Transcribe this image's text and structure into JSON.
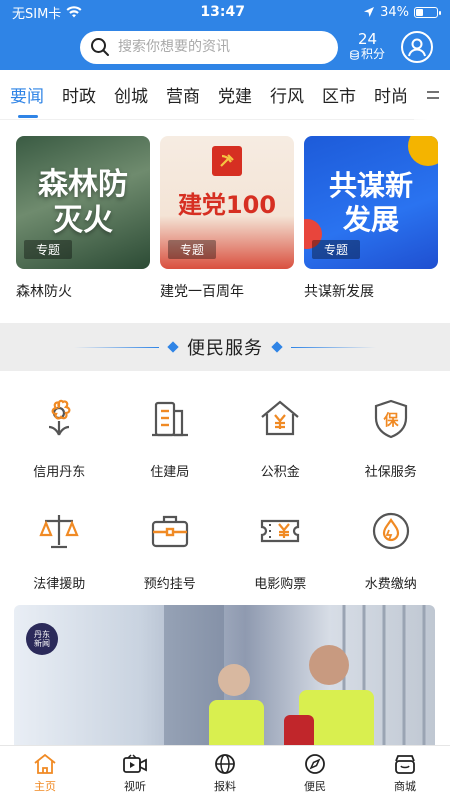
{
  "status": {
    "carrier": "无SIM卡",
    "time": "13:47",
    "battery": "34%",
    "battery_level": 0.34
  },
  "header": {
    "search_placeholder": "搜索你想要的资讯",
    "points_value": "24",
    "points_label": "积分"
  },
  "tabs": [
    {
      "label": "要闻",
      "active": true
    },
    {
      "label": "时政"
    },
    {
      "label": "创城"
    },
    {
      "label": "营商"
    },
    {
      "label": "党建"
    },
    {
      "label": "行风"
    },
    {
      "label": "区市"
    },
    {
      "label": "时尚"
    }
  ],
  "topics": [
    {
      "image_text": "森林防灭火",
      "tag": "专题",
      "caption": "森林防火"
    },
    {
      "image_text": "建党100",
      "tag": "专题",
      "caption": "建党一百周年"
    },
    {
      "image_text": "共谋新发展",
      "tag": "专题",
      "caption": "共谋新发展"
    }
  ],
  "section": {
    "title": "便民服务"
  },
  "services": [
    {
      "label": "信用丹东",
      "icon": "flower-icon"
    },
    {
      "label": "住建局",
      "icon": "building-icon"
    },
    {
      "label": "公积金",
      "icon": "house-yen-icon"
    },
    {
      "label": "社保服务",
      "icon": "shield-bao-icon"
    },
    {
      "label": "法律援助",
      "icon": "scales-icon"
    },
    {
      "label": "预约挂号",
      "icon": "medical-bag-icon"
    },
    {
      "label": "电影购票",
      "icon": "ticket-icon"
    },
    {
      "label": "水费缴纳",
      "icon": "water-drop-icon"
    }
  ],
  "banner": {
    "logo_line1": "丹东",
    "logo_line2": "新闻"
  },
  "tabbar": [
    {
      "label": "主页",
      "icon": "home-icon",
      "active": true
    },
    {
      "label": "视听",
      "icon": "video-icon"
    },
    {
      "label": "报料",
      "icon": "globe-icon"
    },
    {
      "label": "便民",
      "icon": "compass-icon"
    },
    {
      "label": "商城",
      "icon": "shop-icon"
    }
  ],
  "colors": {
    "primary": "#2f84e6",
    "icon_orange": "#f08a24",
    "icon_gray": "#555555"
  }
}
